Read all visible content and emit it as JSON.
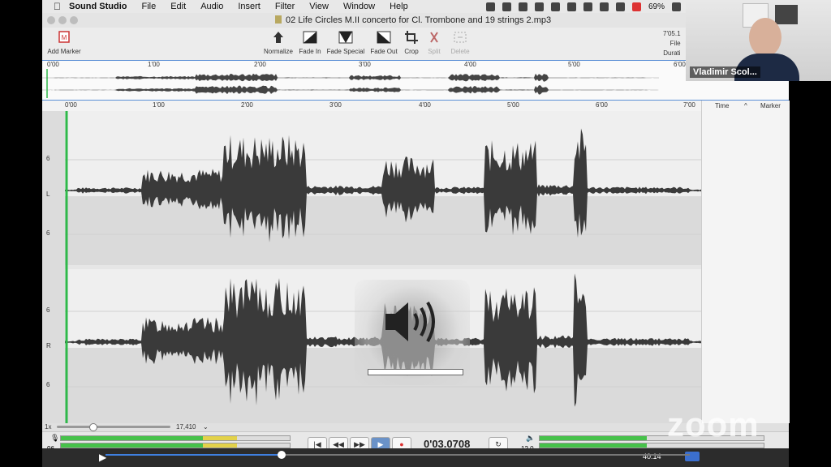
{
  "menubar": {
    "app_name": "Sound Studio",
    "items": [
      "File",
      "Edit",
      "Audio",
      "Insert",
      "Filter",
      "View",
      "Window",
      "Help"
    ],
    "battery": "69%"
  },
  "window": {
    "title": "02 Life Circles M.II concerto for Cl. Trombone and 19 strings 2.mp3"
  },
  "toolbar": {
    "add_marker": "Add Marker",
    "tools": [
      {
        "label": "Normalize",
        "icon": "normalize-icon",
        "enabled": true
      },
      {
        "label": "Fade In",
        "icon": "fade-in-icon",
        "enabled": true
      },
      {
        "label": "Fade Special",
        "icon": "fade-special-icon",
        "enabled": true
      },
      {
        "label": "Fade Out",
        "icon": "fade-out-icon",
        "enabled": true
      },
      {
        "label": "Crop",
        "icon": "crop-icon",
        "enabled": true
      },
      {
        "label": "Split",
        "icon": "split-icon",
        "enabled": false
      },
      {
        "label": "Delete",
        "icon": "delete-icon",
        "enabled": false
      }
    ],
    "duration_value": "7'05.1",
    "file_label": "File",
    "duration_label": "Durati"
  },
  "overview_ruler": [
    "0'00",
    "1'00",
    "2'00",
    "3'00",
    "4'00",
    "5'00",
    "6'00"
  ],
  "main_ruler": [
    "0'00",
    "1'00",
    "2'00",
    "3'00",
    "4'00",
    "5'00",
    "6'00",
    "7'00"
  ],
  "channels": {
    "left": {
      "top_scale": "6",
      "label": "L",
      "bottom_scale": "6"
    },
    "right": {
      "top_scale": "6",
      "label": "R",
      "bottom_scale": "6"
    }
  },
  "marker_panel": {
    "col_time": "Time",
    "col_marker": "Marker"
  },
  "zoombar": {
    "zoom_label": "1x",
    "samples": "17,410"
  },
  "transport": {
    "input_level": "96",
    "timecode": "0'03.0708",
    "output_level": "12.0"
  },
  "video": {
    "participant_name": "Vladimir Scol...",
    "zoom_logo": "zoom"
  },
  "player": {
    "time": "40:14"
  },
  "colors": {
    "waveform": "#3a3a3a",
    "playhead": "#2fb84a",
    "selection_blue": "#5b8fd6",
    "meter_green": "#46c24a"
  }
}
